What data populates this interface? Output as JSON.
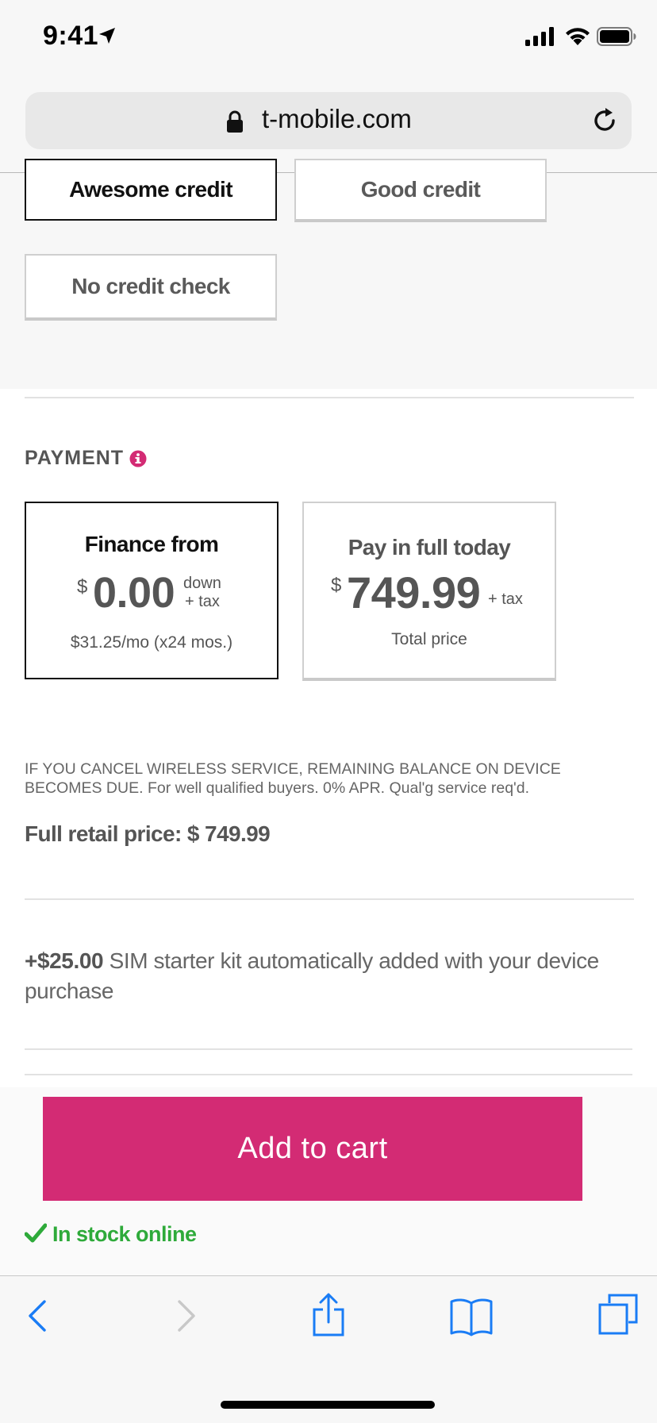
{
  "status_bar": {
    "time": "9:41"
  },
  "browser": {
    "url": "t-mobile.com"
  },
  "credit_options": [
    {
      "label": "Awesome credit",
      "selected": true
    },
    {
      "label": "Good credit",
      "selected": false
    },
    {
      "label": "No credit check",
      "selected": false
    }
  ],
  "payment": {
    "section_label": "PAYMENT",
    "finance": {
      "title": "Finance from",
      "currency": "$",
      "amount": "0.00",
      "suffix_line1": "down",
      "suffix_line2": "+ tax",
      "monthly": "$31.25/mo (x24 mos.)"
    },
    "full": {
      "title": "Pay in full today",
      "currency": "$",
      "amount": "749.99",
      "suffix": "+ tax",
      "caption": "Total price"
    }
  },
  "disclaimer": "IF YOU CANCEL WIRELESS SERVICE, REMAINING BALANCE ON DEVICE BECOMES DUE. For well qualified buyers. 0% APR. Qual'g service req'd.",
  "retail_price": "Full retail price: $ 749.99",
  "sim_kit": {
    "amount": "+$25.00",
    "text": " SIM starter kit automatically added with your device purchase"
  },
  "cart": {
    "button_label": "Add to cart",
    "stock_label": "In stock online"
  },
  "colors": {
    "accent": "#d32b74",
    "in_stock": "#2eaa3a",
    "ios_blue": "#1a7cf5"
  },
  "toolbar_icons": [
    "back-icon",
    "forward-icon",
    "share-icon",
    "bookmarks-icon",
    "tabs-icon"
  ]
}
